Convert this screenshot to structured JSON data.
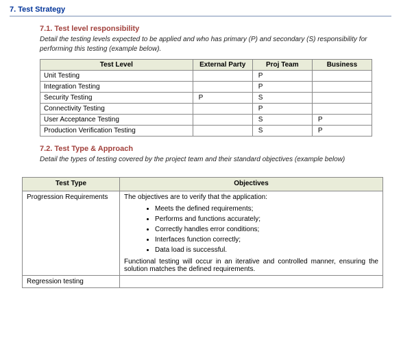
{
  "section": {
    "number_title": "7. Test Strategy"
  },
  "sub1": {
    "title": "7.1. Test level responsibility",
    "desc": "Detail the testing levels expected to be applied and who has primary (P) and secondary (S) responsibility for performing this testing (example below).",
    "headers": {
      "level": "Test Level",
      "c1": "External Party",
      "c2": "Proj Team",
      "c3": "Business"
    },
    "rows": [
      {
        "level": "Unit Testing",
        "c1": "",
        "c2": "P",
        "c3": ""
      },
      {
        "level": "Integration Testing",
        "c1": "",
        "c2": "P",
        "c3": ""
      },
      {
        "level": "Security Testing",
        "c1": "P",
        "c2": "S",
        "c3": ""
      },
      {
        "level": "Connectivity Testing",
        "c1": "",
        "c2": "P",
        "c3": ""
      },
      {
        "level": "User Acceptance Testing",
        "c1": "",
        "c2": "S",
        "c3": "P"
      },
      {
        "level": "Production Verification Testing",
        "c1": "",
        "c2": "S",
        "c3": "P"
      }
    ]
  },
  "sub2": {
    "title": "7.2. Test Type & Approach",
    "desc": "Detail the types of testing covered by the project team and their standard objectives (example below)",
    "headers": {
      "type": "Test Type",
      "obj": "Objectives"
    },
    "rows": [
      {
        "type": "Progression Requirements",
        "intro": "The objectives are to verify that the application:",
        "bullets": [
          "Meets the defined requirements;",
          "Performs and functions accurately;",
          "Correctly handles error conditions;",
          "Interfaces function correctly;",
          "Data load is successful."
        ],
        "outro": "Functional testing will occur in an iterative and controlled manner, ensuring the solution matches the defined requirements."
      },
      {
        "type": "Regression testing",
        "intro": "",
        "bullets": [],
        "outro": ""
      }
    ]
  }
}
